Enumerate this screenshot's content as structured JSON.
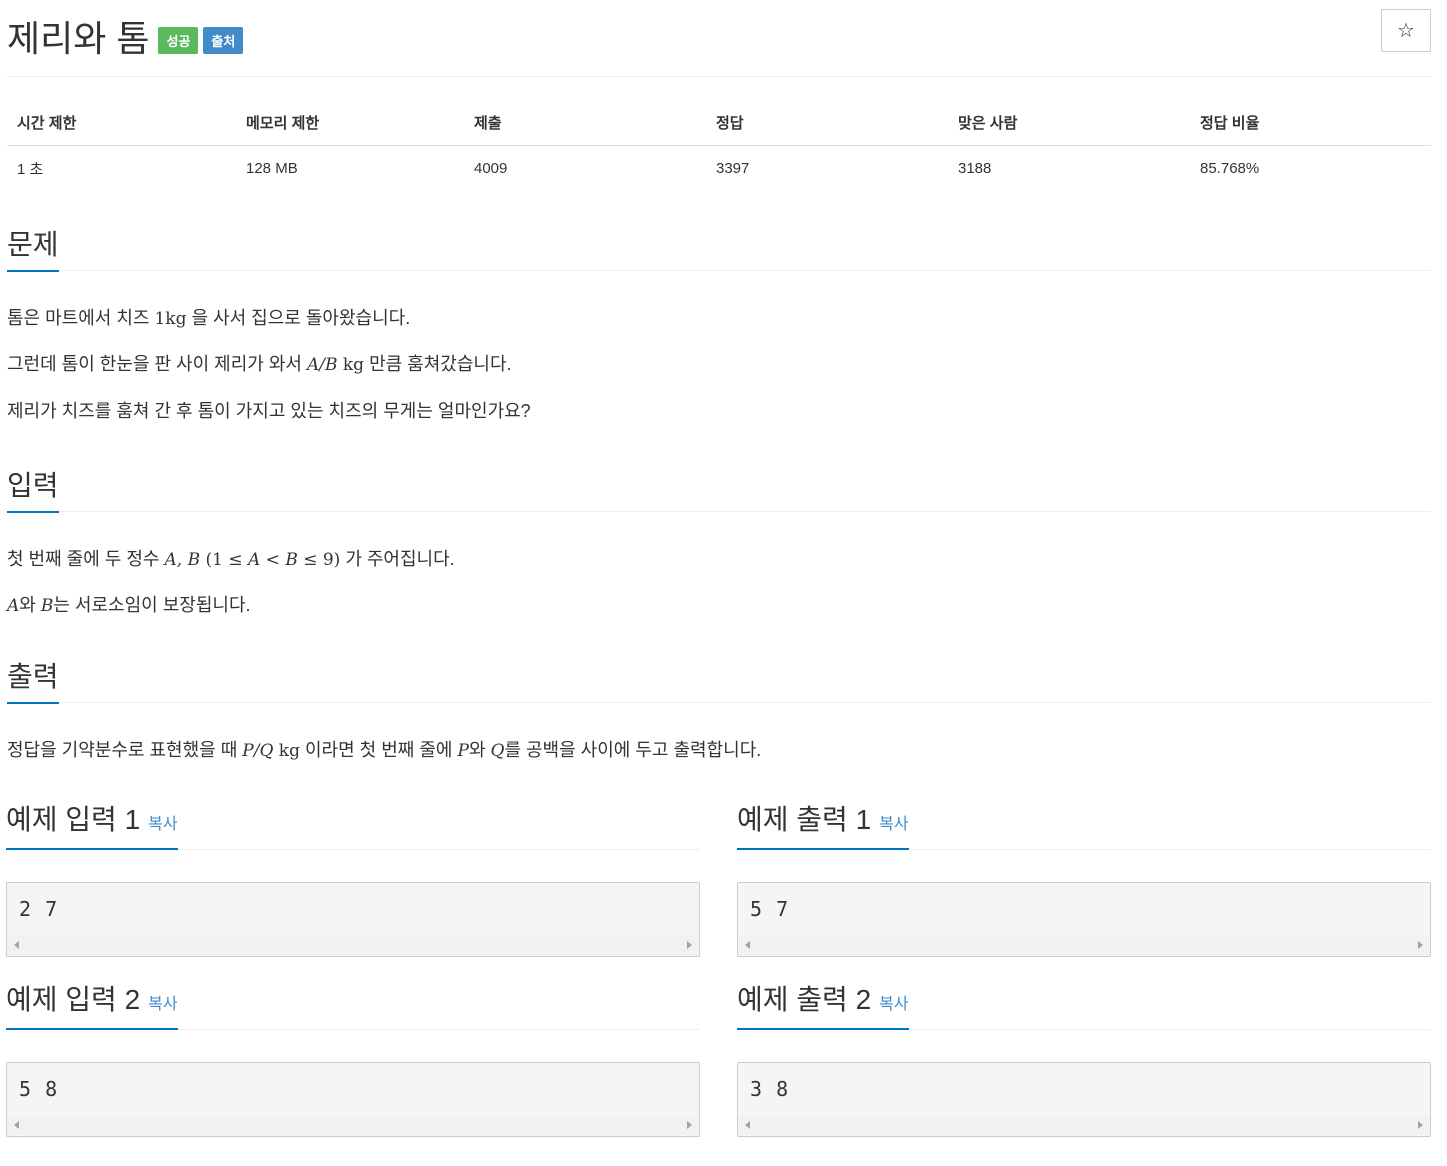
{
  "problem": {
    "title": "제리와 톰",
    "badges": {
      "success": "성공",
      "source": "출처"
    },
    "star_glyph": "☆"
  },
  "info": {
    "headers": [
      "시간 제한",
      "메모리 제한",
      "제출",
      "정답",
      "맞은 사람",
      "정답 비율"
    ],
    "values": [
      "1 초",
      "128 MB",
      "4009",
      "3397",
      "3188",
      "85.768%"
    ]
  },
  "sections": {
    "description": {
      "heading": "문제",
      "p1": {
        "before": "톰은 마트에서 치즈 ",
        "math": "1kg",
        "after": " 을 사서 집으로 돌아왔습니다."
      },
      "p2": {
        "before": "그런데 톰이 한눈을 판 사이 제리가 와서 ",
        "math_italic": "A/B",
        "math_unit": " kg",
        "after": " 만큼 훔쳐갔습니다."
      },
      "p3": "제리가 치즈를 훔쳐 간 후 톰이 가지고 있는 치즈의 무게는 얼마인가요?"
    },
    "input": {
      "heading": "입력",
      "p1": {
        "before": "첫 번째 줄에 두 정수 ",
        "vars": "A, B",
        "math": " (1 ≤ ",
        "a": "A",
        "lt": " < ",
        "b": "B",
        "le": " ≤ 9)",
        "after": " 가 주어집니다."
      },
      "p2": {
        "a": "A",
        "mid": "와 ",
        "b": "B",
        "after": "는 서로소임이 보장됩니다."
      }
    },
    "output": {
      "heading": "출력",
      "p1": {
        "before": "정답을 기약분수로 표현했을 때 ",
        "frac": "P/Q",
        "unit": " kg",
        "mid": " 이라면 첫 번째 줄에 ",
        "p": "P",
        "wa": "와 ",
        "q": "Q",
        "after": "를 공백을 사이에 두고 출력합니다."
      }
    }
  },
  "samples": {
    "copy_label": "복사",
    "input1": {
      "heading": "예제 입력 1",
      "content": "2 7"
    },
    "output1": {
      "heading": "예제 출력 1",
      "content": "5 7"
    },
    "input2": {
      "heading": "예제 입력 2",
      "content": "5 8"
    },
    "output2": {
      "heading": "예제 출력 2",
      "content": "3 8"
    }
  }
}
